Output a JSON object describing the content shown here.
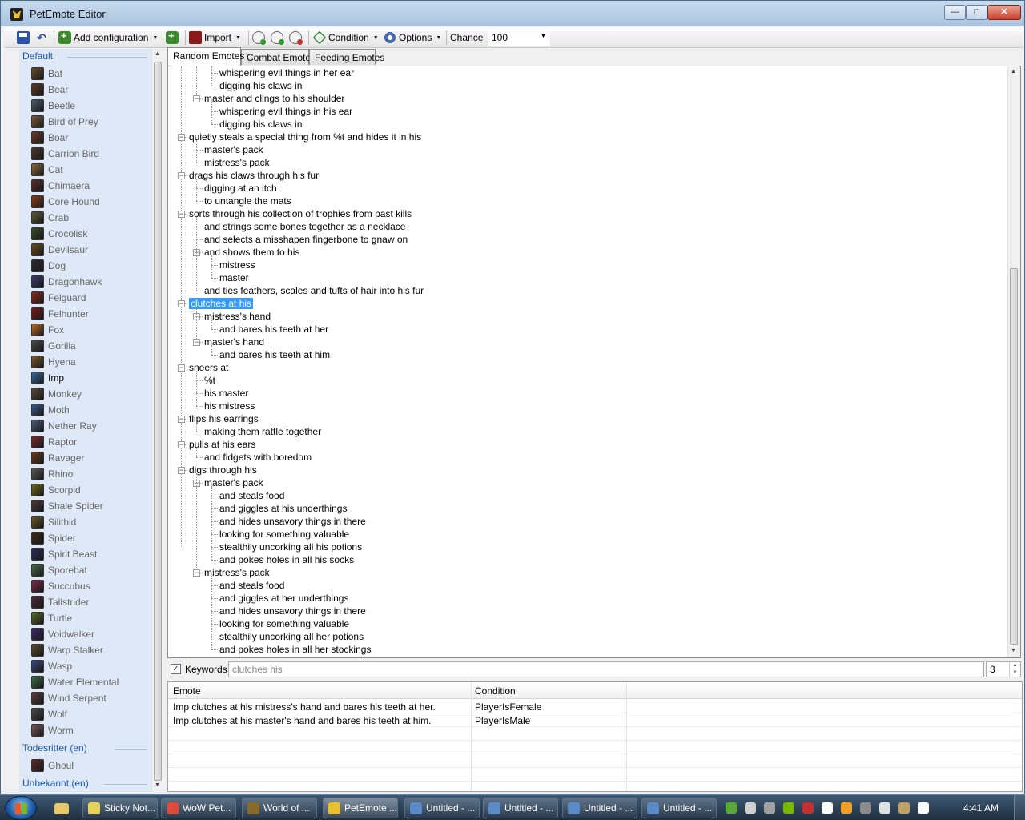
{
  "window": {
    "title": "PetEmote Editor"
  },
  "toolbar": {
    "add_configuration": "Add configuration",
    "import": "Import",
    "condition": "Condition",
    "options": "Options",
    "chance_label": "Chance",
    "chance_value": "100"
  },
  "sidebar": {
    "groups": [
      {
        "name": "Default",
        "pets": [
          "Bat",
          "Bear",
          "Beetle",
          "Bird of Prey",
          "Boar",
          "Carrion Bird",
          "Cat",
          "Chimaera",
          "Core Hound",
          "Crab",
          "Crocolisk",
          "Devilsaur",
          "Dog",
          "Dragonhawk",
          "Felguard",
          "Felhunter",
          "Fox",
          "Gorilla",
          "Hyena",
          "Imp",
          "Monkey",
          "Moth",
          "Nether Ray",
          "Raptor",
          "Ravager",
          "Rhino",
          "Scorpid",
          "Shale Spider",
          "Silithid",
          "Spider",
          "Spirit Beast",
          "Sporebat",
          "Succubus",
          "Tallstrider",
          "Turtle",
          "Voidwalker",
          "Warp Stalker",
          "Wasp",
          "Water Elemental",
          "Wind Serpent",
          "Wolf",
          "Worm"
        ]
      },
      {
        "name": "Todesritter (en)",
        "pets": [
          "Ghoul"
        ]
      },
      {
        "name": "Unbekannt (en)",
        "pets": []
      }
    ],
    "selected_pet": "Imp"
  },
  "tabs": [
    "Random Emotes",
    "Combat Emotes",
    "Feeding Emotes"
  ],
  "active_tab": "Random Emotes",
  "tree": [
    {
      "text": "whispering evil things in her ear",
      "level": 2
    },
    {
      "text": "digging his claws in",
      "level": 2
    },
    {
      "text": "master and clings to his shoulder",
      "level": 1,
      "expanded": true
    },
    {
      "text": "whispering evil things in his ear",
      "level": 2
    },
    {
      "text": "digging his claws in",
      "level": 2
    },
    {
      "text": "quietly steals a special thing from %t and hides it in his",
      "level": 0,
      "expanded": true
    },
    {
      "text": "master's pack",
      "level": 1
    },
    {
      "text": "mistress's pack",
      "level": 1
    },
    {
      "text": "drags his claws through his fur",
      "level": 0,
      "expanded": true
    },
    {
      "text": "digging at an itch",
      "level": 1
    },
    {
      "text": "to untangle the mats",
      "level": 1
    },
    {
      "text": "sorts through his collection of trophies from past kills",
      "level": 0,
      "expanded": true
    },
    {
      "text": "and strings some bones together as a necklace",
      "level": 1
    },
    {
      "text": "and selects a misshapen fingerbone to gnaw on",
      "level": 1
    },
    {
      "text": "and shows them to his",
      "level": 1,
      "expanded": true
    },
    {
      "text": "mistress",
      "level": 2
    },
    {
      "text": "master",
      "level": 2
    },
    {
      "text": "and ties feathers, scales and tufts of hair into his fur",
      "level": 1
    },
    {
      "text": "clutches at his",
      "level": 0,
      "expanded": true,
      "selected": true
    },
    {
      "text": "mistress's hand",
      "level": 1,
      "expanded": true
    },
    {
      "text": "and bares his teeth at her",
      "level": 2
    },
    {
      "text": "master's hand",
      "level": 1,
      "expanded": true
    },
    {
      "text": "and bares his teeth at him",
      "level": 2
    },
    {
      "text": "sneers at",
      "level": 0,
      "expanded": true
    },
    {
      "text": "%t",
      "level": 1
    },
    {
      "text": "his master",
      "level": 1
    },
    {
      "text": "his mistress",
      "level": 1
    },
    {
      "text": "flips his earrings",
      "level": 0,
      "expanded": true
    },
    {
      "text": "making them rattle together",
      "level": 1
    },
    {
      "text": "pulls at his ears",
      "level": 0,
      "expanded": true
    },
    {
      "text": "and fidgets with boredom",
      "level": 1
    },
    {
      "text": "digs through his",
      "level": 0,
      "expanded": true
    },
    {
      "text": "master's pack",
      "level": 1,
      "expanded": true
    },
    {
      "text": "and steals food",
      "level": 2
    },
    {
      "text": "and giggles at his underthings",
      "level": 2
    },
    {
      "text": "and hides unsavory things in there",
      "level": 2
    },
    {
      "text": "looking for something valuable",
      "level": 2
    },
    {
      "text": "stealthily uncorking all his potions",
      "level": 2
    },
    {
      "text": "and pokes holes in all his socks",
      "level": 2
    },
    {
      "text": "mistress's pack",
      "level": 1,
      "expanded": true
    },
    {
      "text": "and steals food",
      "level": 2
    },
    {
      "text": "and giggles at her underthings",
      "level": 2
    },
    {
      "text": "and hides unsavory things in there",
      "level": 2
    },
    {
      "text": "looking for something valuable",
      "level": 2
    },
    {
      "text": "stealthily uncorking all her potions",
      "level": 2
    },
    {
      "text": "and pokes holes in all her stockings",
      "level": 2
    }
  ],
  "keywords": {
    "label": "Keywords",
    "checked": true,
    "value": "clutches his",
    "count": "3"
  },
  "preview": {
    "columns": [
      "Emote",
      "Condition"
    ],
    "rows": [
      {
        "emote": "Imp clutches at his mistress's hand and bares his teeth at her.",
        "condition": "PlayerIsFemale"
      },
      {
        "emote": "Imp clutches at his master's hand and bares his teeth at him.",
        "condition": "PlayerIsMale"
      }
    ]
  },
  "taskbar": {
    "items": [
      {
        "label": "Sticky Not...",
        "color": "#e6d35a"
      },
      {
        "label": "WoW Pet...",
        "color": "#dd4b39"
      },
      {
        "label": "World of ...",
        "color": "#8a6a2a"
      },
      {
        "label": "PetEmote ...",
        "color": "#e8c030",
        "active": true
      },
      {
        "label": "Untitled - ...",
        "color": "#5a8ac8"
      },
      {
        "label": "Untitled - ...",
        "color": "#5a8ac8"
      },
      {
        "label": "Untitled - ...",
        "color": "#5a8ac8"
      },
      {
        "label": "Untitled - ...",
        "color": "#5a8ac8"
      }
    ],
    "clock": "4:41 AM",
    "tray_colors": [
      "#5aa83a",
      "#d0d0d0",
      "#a0a0a0",
      "#76b900",
      "#c43030",
      "#ffffff",
      "#f0a020",
      "#8a8a8a",
      "#e0e0e0",
      "#c0a060",
      "#ffffff"
    ]
  }
}
